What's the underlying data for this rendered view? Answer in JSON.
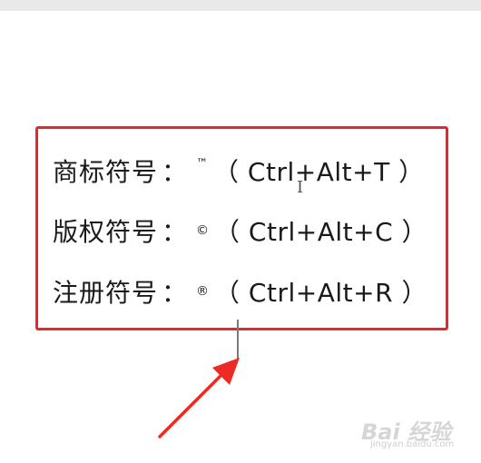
{
  "lines": [
    {
      "label": "商标符号",
      "colon": "：",
      "symbol": "™",
      "shortcut": "（ Ctrl+Alt+T ）"
    },
    {
      "label": "版权符号",
      "colon": "：",
      "symbol": "©",
      "shortcut": "（ Ctrl+Alt+C ）"
    },
    {
      "label": "注册符号",
      "colon": "：",
      "symbol": "®",
      "shortcut": "（ Ctrl+Alt+R ）"
    }
  ],
  "cursor_glyph": "I",
  "watermark": {
    "main": "Bai 经验",
    "sub": "jingyan.baidu.com"
  },
  "colors": {
    "highlight": "#e8262b",
    "text": "#1a1a1a",
    "top_strip": "#e9e9e9"
  }
}
